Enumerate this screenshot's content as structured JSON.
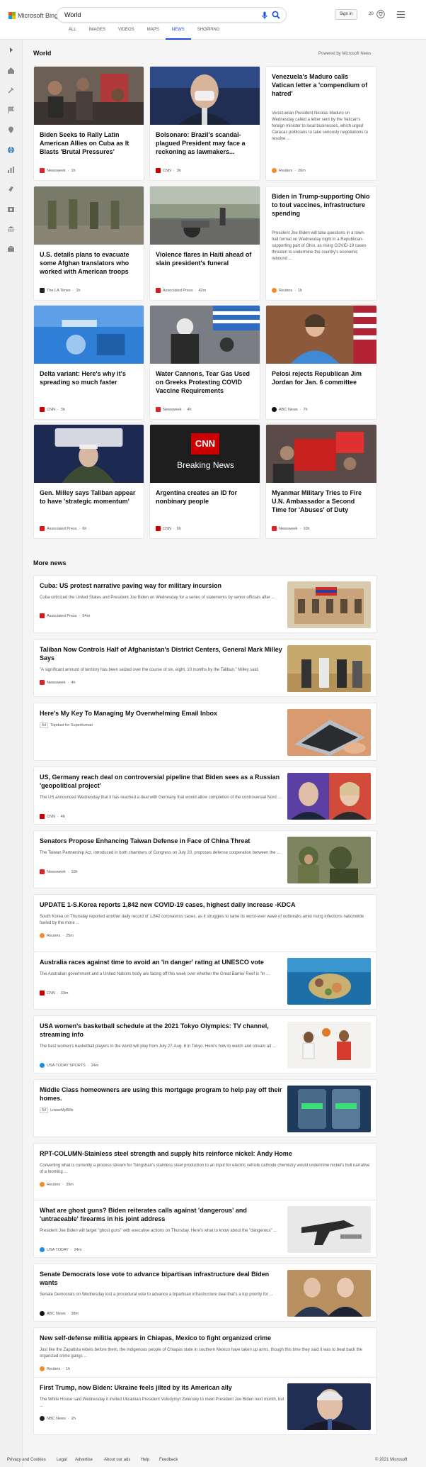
{
  "brand": "Microsoft Bing",
  "search": {
    "value": "World"
  },
  "tabs": [
    {
      "label": "ALL"
    },
    {
      "label": "IMAGES"
    },
    {
      "label": "VIDEOS"
    },
    {
      "label": "MAPS"
    },
    {
      "label": "NEWS"
    },
    {
      "label": "SHOPPING"
    }
  ],
  "header": {
    "signin": "Sign in",
    "rewards": "20"
  },
  "section_title": "World",
  "powered_by": "Powered by Microsoft News",
  "cards": [
    {
      "title": "Biden Seeks to Rally Latin American Allies on Cuba as It Blasts 'Brutal Pressures'",
      "source": "Newsweek",
      "time": "1h",
      "source_color": "#d9252a",
      "desc": ""
    },
    {
      "title": "Bolsonaro: Brazil's scandal-plagued President may face a reckoning as lawmakers...",
      "source": "CNN",
      "time": "3h",
      "source_color": "#cc0000",
      "desc": ""
    },
    {
      "title": "Venezuela's Maduro calls Vatican letter a 'compendium of hatred'",
      "source": "Reuters",
      "time": "26m",
      "source_color": "#f28c28",
      "desc": "Venezuelan President Nicolas Maduro on Wednesday called a letter sent by the Vatican's foreign minister to local businesses, which urged Caracas politicians to take seriously negotiations to resolve ..."
    },
    {
      "title": "U.S. details plans to evacuate some Afghan translators who worked with American troops",
      "source": "The LA Times",
      "time": "1h",
      "source_color": "#222222",
      "desc": ""
    },
    {
      "title": "Violence flares in Haiti ahead of slain president's funeral",
      "source": "Associated Press",
      "time": "42m",
      "source_color": "#d41a1a",
      "desc": ""
    },
    {
      "title": "Biden in Trump-supporting Ohio to tout vaccines, infrastructure spending",
      "source": "Reuters",
      "time": "1h",
      "source_color": "#f28c28",
      "desc": "President Joe Biden will take questions in a town-hall format on Wednesday night in a Republican-supporting part of Ohio, as rising COVID-19 cases threaten to undermine the country's economic rebound ..."
    },
    {
      "title": "Delta variant: Here's why it's spreading so much faster",
      "source": "CNN",
      "time": "3h",
      "source_color": "#cc0000",
      "desc": ""
    },
    {
      "title": "Water Cannons, Tear Gas Used on Greeks Protesting COVID Vaccine Requirements",
      "source": "Newsweek",
      "time": "4h",
      "source_color": "#d9252a",
      "desc": ""
    },
    {
      "title": "Pelosi rejects Republican Jim Jordan for Jan. 6 committee",
      "source": "ABC News",
      "time": "7h",
      "source_color": "#111111",
      "desc": ""
    },
    {
      "title": "Gen. Milley says Taliban appear to have 'strategic momentum'",
      "source": "Associated Press",
      "time": "6h",
      "source_color": "#d41a1a",
      "desc": ""
    },
    {
      "title": "Argentina creates an ID for nonbinary people",
      "source": "CNN",
      "time": "5h",
      "source_color": "#cc0000",
      "desc": ""
    },
    {
      "title": "Myanmar Military Tries to Fire U.N. Ambassador a Second Time for 'Abuses' of Duty",
      "source": "Newsweek",
      "time": "10h",
      "source_color": "#d9252a",
      "desc": ""
    }
  ],
  "cnn_card": {
    "logo": "CNN",
    "text": "Breaking News"
  },
  "pentagon_text": "THE PENTAGON",
  "more_news_title": "More news",
  "more_news": [
    {
      "title": "Cuba: US protest narrative paving way for military incursion",
      "desc": "Cuba criticized the United States and President Joe Biden on Wednesday for a series of statements by senior officials after ...",
      "source": "Associated Press",
      "time": "54m",
      "source_color": "#d41a1a",
      "has_image": true,
      "ad": false
    },
    {
      "title": "Taliban Now Controls Half of Afghanistan's District Centers, General Mark Milley Says",
      "desc": "\"A significant amount of territory has been seized over the course of six, eight, 10 months by the Taliban,\" Milley said.",
      "source": "Newsweek",
      "time": "4h",
      "source_color": "#d9252a",
      "has_image": true,
      "ad": false
    },
    {
      "title": "Here's My Key To Managing My Overwhelming Email Inbox",
      "desc": "",
      "source": "Topdust for Superhuman",
      "time": "",
      "source_color": "",
      "has_image": true,
      "ad": true
    },
    {
      "title": "US, Germany reach deal on controversial pipeline that Biden sees as a Russian 'geopolitical project'",
      "desc": "The US announced Wednesday that it has reached a deal with Germany that would allow completion of the controversial Nord ...",
      "source": "CNN",
      "time": "4h",
      "source_color": "#cc0000",
      "has_image": true,
      "ad": false
    },
    {
      "title": "Senators Propose Enhancing Taiwan Defense in Face of China Threat",
      "desc": "The Taiwan Partnership Act, introduced in both chambers of Congress on July 20, proposes defense cooperation between the ...",
      "source": "Newsweek",
      "time": "10h",
      "source_color": "#d9252a",
      "has_image": true,
      "ad": false
    },
    {
      "title": "UPDATE 1-S.Korea reports 1,842 new COVID-19 cases, highest daily increase -KDCA",
      "desc": "South Korea on Thursday reported another daily record of 1,842 coronavirus cases, as it struggles to tame its worst-ever wave of outbreaks amid rising infections nationwide fueled by the more ...",
      "source": "Reuters",
      "time": "25m",
      "source_color": "#f28c28",
      "has_image": false,
      "ad": false
    },
    {
      "title": "Australia races against time to avoid an 'in danger' rating at UNESCO vote",
      "desc": "The Australian government and a United Nations body are facing off this week over whether the Great Barrier Reef is \"in ...",
      "source": "CNN",
      "time": "33m",
      "source_color": "#cc0000",
      "has_image": true,
      "ad": false
    },
    {
      "title": "USA women's basketball schedule at the 2021 Tokyo Olympics: TV channel, streaming info",
      "desc": "The best women's basketball players in the world will play from July 27-Aug. 8 in Tokyo. Here's how to watch and stream all ...",
      "source": "USA TODAY SPORTS",
      "time": "24m",
      "source_color": "#1a8fe3",
      "has_image": true,
      "ad": false
    },
    {
      "title": "Middle Class homeowners are using this mortgage program to help pay off their homes.",
      "desc": "",
      "source": "LowerMyBills",
      "time": "",
      "source_color": "",
      "has_image": true,
      "ad": true
    },
    {
      "title": "RPT-COLUMN-Stainless steel strength and supply hits reinforce nickel: Andy Home",
      "desc": "Converting what is currently a process stream for Tsingshan's stainless steel production to an input for electric vehicle cathode chemistry would undermine nickel's bull narrative of a looming ...",
      "source": "Reuters",
      "time": "39m",
      "source_color": "#f28c28",
      "has_image": false,
      "ad": false
    },
    {
      "title": "What are ghost guns? Biden reiterates calls against 'dangerous' and 'untraceable' firearms in his joint address",
      "desc": "President Joe Biden will target \"ghost guns\" with executive actions on Thursday. Here's what to know about the \"dangerous\" ...",
      "source": "USA TODAY",
      "time": "24m",
      "source_color": "#1a8fe3",
      "has_image": true,
      "ad": false
    },
    {
      "title": "Senate Democrats lose vote to advance bipartisan infrastructure deal Biden wants",
      "desc": "Senate Democrats on Wednesday lost a procedural vote to advance a bipartisan infrastructure deal that's a top priority for ...",
      "source": "ABC News",
      "time": "38m",
      "source_color": "#111111",
      "has_image": true,
      "ad": false
    },
    {
      "title": "New self-defense militia appears in Chiapas, Mexico to fight organized crime",
      "desc": "Just like the Zapatista rebels before them, the indigenous people of Chiapas state in southern Mexico have taken up arms, though this time they said it was to beat back the organized crime gangs ...",
      "source": "Reuters",
      "time": "1h",
      "source_color": "#f28c28",
      "has_image": false,
      "ad": false
    },
    {
      "title": "First Trump, now Biden: Ukraine feels jilted by its American ally",
      "desc": "The White House said Wednesday it invited Ukrainian President Volodymyr Zelensky to meet President Joe Biden next month, but ...",
      "source": "NBC News",
      "time": "2h",
      "source_color": "#222222",
      "has_image": true,
      "ad": false
    }
  ],
  "ad_label": "Ad",
  "footer": {
    "links": [
      "Privacy and Cookies",
      "Legal",
      "Advertise",
      "About our ads",
      "Help",
      "Feedback"
    ],
    "copyright": "© 2021 Microsoft"
  }
}
